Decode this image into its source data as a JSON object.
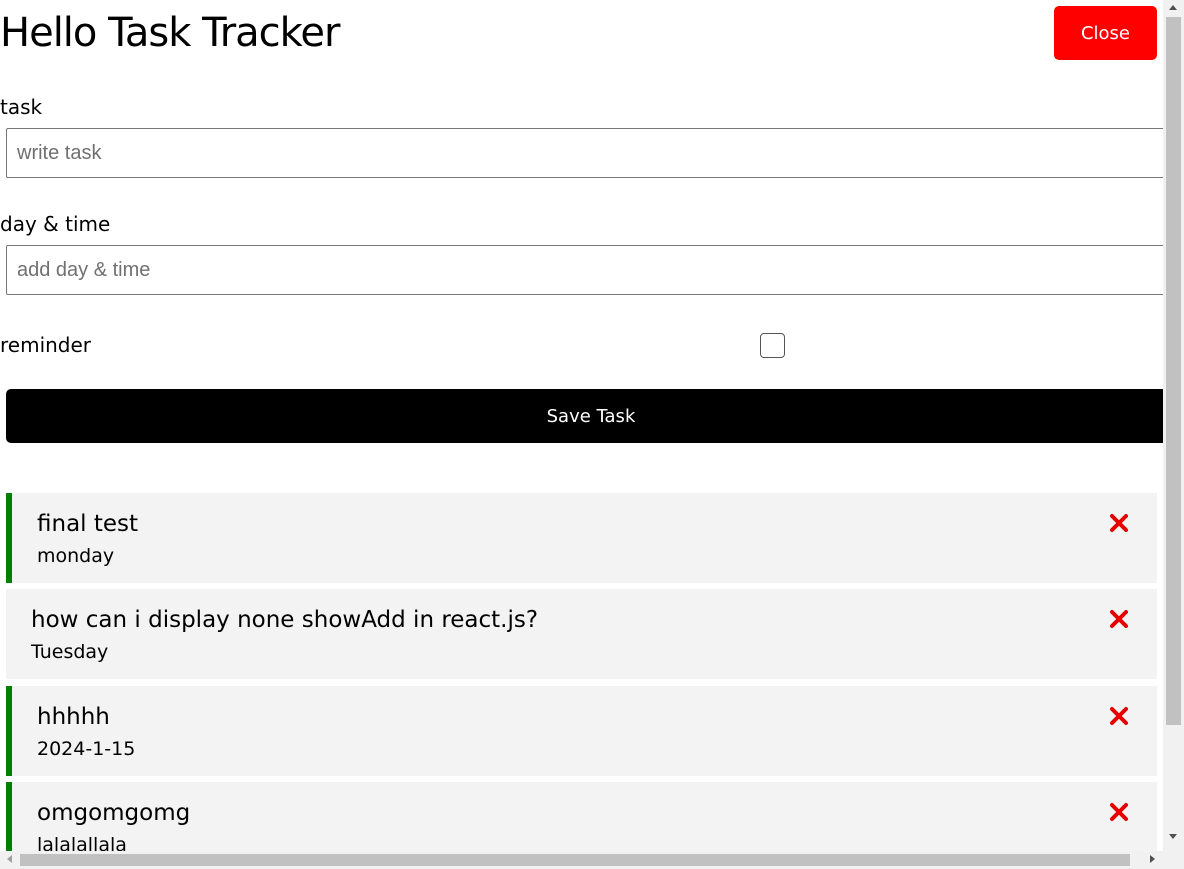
{
  "header": {
    "title": "Hello Task Tracker",
    "close_label": "Close"
  },
  "form": {
    "task_label": "task",
    "task_placeholder": "write task",
    "day_label": "day & time",
    "day_placeholder": "add day & time",
    "reminder_label": "reminder",
    "reminder_checked": false,
    "save_label": "Save Task"
  },
  "tasks": [
    {
      "title": "final test",
      "day": "monday",
      "reminder": true
    },
    {
      "title": "how can i display none showAdd in react.js?",
      "day": "Tuesday",
      "reminder": false
    },
    {
      "title": "hhhhh",
      "day": "2024-1-15",
      "reminder": true
    },
    {
      "title": "omgomgomg",
      "day": "lalalallala",
      "reminder": true
    }
  ],
  "colors": {
    "accent_close": "#ff0000",
    "reminder_border": "#008000",
    "delete_icon": "#e60000"
  },
  "icons": {
    "delete": "times-icon"
  }
}
